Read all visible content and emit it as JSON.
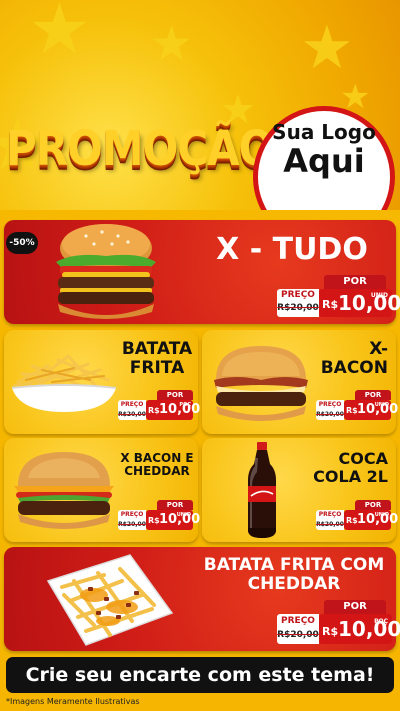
{
  "header": {
    "title": "PROMOÇÃO",
    "logo_line1": "Sua Logo",
    "logo_line2": "Aqui"
  },
  "featured": {
    "badge": "-50%",
    "name": "X - TUDO",
    "por": "POR",
    "preco_label": "PREÇO",
    "old_price": "R$20,00",
    "currency": "R$",
    "new_price": "10,00",
    "unit": "UNID"
  },
  "products": [
    {
      "name": "BATATA FRITA",
      "por": "POR",
      "preco_label": "PREÇO",
      "old_price": "R$20,00",
      "currency": "R$",
      "new_price": "10,00",
      "unit": "POÇ"
    },
    {
      "name": "X- BACON",
      "por": "POR",
      "preco_label": "PREÇO",
      "old_price": "R$20,00",
      "currency": "R$",
      "new_price": "10,00",
      "unit": "UNID"
    },
    {
      "name": "X BACON E CHEDDAR",
      "por": "POR",
      "preco_label": "PREÇO",
      "old_price": "R$20,00",
      "currency": "R$",
      "new_price": "10,00",
      "unit": "UNID"
    },
    {
      "name": "COCA COLA 2L",
      "por": "POR",
      "preco_label": "PREÇO",
      "old_price": "R$20,00",
      "currency": "R$",
      "new_price": "10,00",
      "unit": "UNID"
    }
  ],
  "bottom": {
    "name": "BATATA FRITA COM CHEDDAR",
    "por": "POR",
    "preco_label": "PREÇO",
    "old_price": "R$20,00",
    "currency": "R$",
    "new_price": "10,00",
    "unit": "POÇ"
  },
  "footer": {
    "cta": "Crie seu encarte com este tema!",
    "disclaimer": "*Imagens Meramente Ilustrativas"
  },
  "colors": {
    "red": "#d41515",
    "yellow": "#f9c51a",
    "dark": "#111111"
  }
}
